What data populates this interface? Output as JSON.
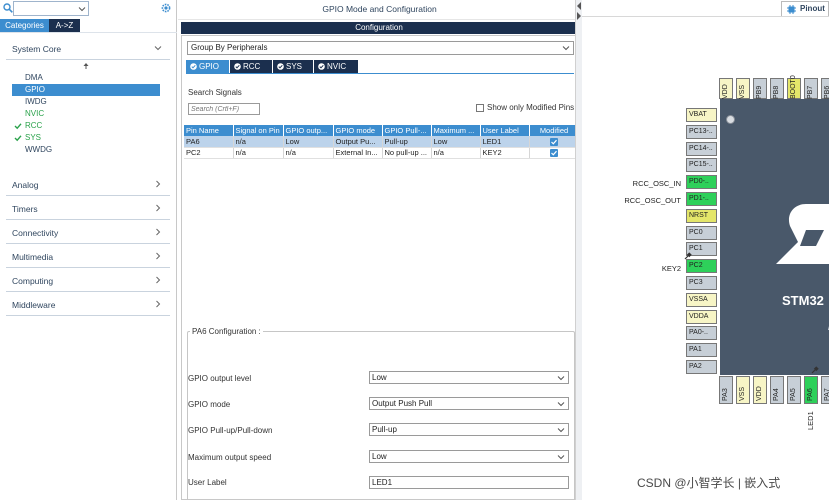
{
  "left": {
    "tabs": [
      "Categories",
      "A->Z"
    ],
    "system_core": {
      "label": "System Core",
      "items": [
        {
          "label": "DMA",
          "state": "normal"
        },
        {
          "label": "GPIO",
          "state": "selected"
        },
        {
          "label": "IWDG",
          "state": "normal"
        },
        {
          "label": "NVIC",
          "state": "enabled"
        },
        {
          "label": "RCC",
          "state": "checked"
        },
        {
          "label": "SYS",
          "state": "checked"
        },
        {
          "label": "WWDG",
          "state": "normal"
        }
      ]
    },
    "categories": [
      "Analog",
      "Timers",
      "Connectivity",
      "Multimedia",
      "Computing",
      "Middleware"
    ]
  },
  "middle": {
    "title": "GPIO Mode and Configuration",
    "config_bar": "Configuration",
    "group_by": "Group By Peripherals",
    "peripheral_tabs": [
      "GPIO",
      "RCC",
      "SYS",
      "NVIC"
    ],
    "search_label": "Search Signals",
    "search_placeholder": "Search (Crtl+F)",
    "show_modified_label": "Show only Modified Pins",
    "table": {
      "headers": [
        "Pin Name",
        "Signal on Pin",
        "GPIO outp...",
        "GPIO mode",
        "GPIO Pull-...",
        "Maximum ...",
        "User Label",
        "Modified"
      ],
      "rows": [
        [
          "PA6",
          "n/a",
          "Low",
          "Output Pu...",
          "Pull-up",
          "Low",
          "LED1",
          "checked"
        ],
        [
          "PC2",
          "n/a",
          "n/a",
          "External In...",
          "No pull-up ...",
          "n/a",
          "KEY2",
          "checked"
        ]
      ]
    },
    "pa6_config": {
      "legend": "PA6 Configuration :",
      "rows": [
        {
          "label": "GPIO output level",
          "value": "Low"
        },
        {
          "label": "GPIO mode",
          "value": "Output Push Pull"
        },
        {
          "label": "GPIO Pull-up/Pull-down",
          "value": "Pull-up"
        },
        {
          "label": "Maximum output speed",
          "value": "Low"
        },
        {
          "label": "User Label",
          "value": "LED1"
        }
      ]
    }
  },
  "right": {
    "tab_label": "Pinout",
    "chip_name": "STM32",
    "chip_sub": "L",
    "left_pins": [
      {
        "name": "VBAT",
        "color": "#f7f5c6"
      },
      {
        "name": "PC13-..",
        "color": "#c7cfd7"
      },
      {
        "name": "PC14-..",
        "color": "#c7cfd7"
      },
      {
        "name": "PC15-..",
        "color": "#c7cfd7"
      },
      {
        "name": "PD0-..",
        "color": "#2ed05a"
      },
      {
        "name": "PD1-..",
        "color": "#2ed05a"
      },
      {
        "name": "NRST",
        "color": "#e4e66a"
      },
      {
        "name": "PC0",
        "color": "#c7cfd7"
      },
      {
        "name": "PC1",
        "color": "#c7cfd7"
      },
      {
        "name": "PC2",
        "color": "#2ed05a"
      },
      {
        "name": "PC3",
        "color": "#c7cfd7"
      },
      {
        "name": "VSSA",
        "color": "#f7f5c6"
      },
      {
        "name": "VDDA",
        "color": "#f7f5c6"
      },
      {
        "name": "PA0-..",
        "color": "#c7cfd7"
      },
      {
        "name": "PA1",
        "color": "#c7cfd7"
      },
      {
        "name": "PA2",
        "color": "#c7cfd7"
      }
    ],
    "top_pins": [
      {
        "name": "VDD",
        "color": "#f7f5c6"
      },
      {
        "name": "VSS",
        "color": "#f7f5c6"
      },
      {
        "name": "PB9",
        "color": "#c7cfd7"
      },
      {
        "name": "PB8",
        "color": "#c7cfd7"
      },
      {
        "name": "BOOT0",
        "color": "#e4e66a"
      },
      {
        "name": "PB7",
        "color": "#c7cfd7"
      },
      {
        "name": "PB6",
        "color": "#c7cfd7"
      }
    ],
    "bottom_pins": [
      {
        "name": "PA3",
        "color": "#c7cfd7"
      },
      {
        "name": "VSS",
        "color": "#f7f5c6"
      },
      {
        "name": "VDD",
        "color": "#f7f5c6"
      },
      {
        "name": "PA4",
        "color": "#c7cfd7"
      },
      {
        "name": "PA5",
        "color": "#c7cfd7"
      },
      {
        "name": "PA6",
        "color": "#2ed05a"
      },
      {
        "name": "PA7",
        "color": "#c7cfd7"
      }
    ],
    "external_labels": {
      "rcc_osc_in": "RCC_OSC_IN",
      "rcc_osc_out": "RCC_OSC_OUT",
      "key2": "KEY2",
      "led1": "LED1"
    },
    "watermark": "CSDN @小智学长 | 嵌入式"
  },
  "colors": {
    "accent_blue": "#3c8dcf",
    "dark_navy": "#1b2f4e",
    "enabled_green": "#2aa24b",
    "pin_green": "#2ed05a",
    "chip_body": "#49586a"
  }
}
